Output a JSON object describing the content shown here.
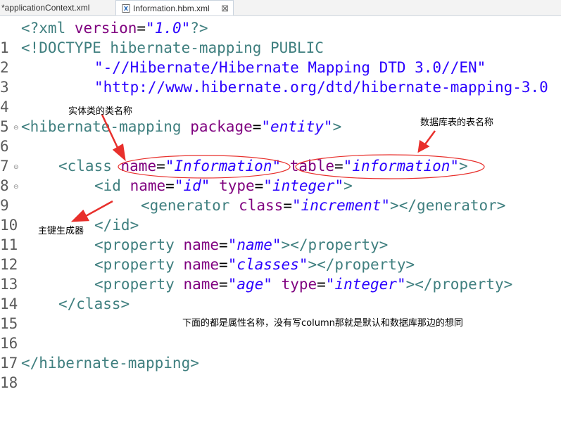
{
  "tabs": [
    {
      "label": "*applicationContext.xml",
      "active": false
    },
    {
      "label": "Information.hbm.xml",
      "active": true
    }
  ],
  "close_glyph": "⊠",
  "colors": {
    "tag": "#3f7f7f",
    "attribute": "#7f007f",
    "attribute_value": "#2a00ff",
    "annotation_red": "#e8302c"
  },
  "editor": {
    "lines": [
      {
        "num": "1"
      },
      {
        "num": "2"
      },
      {
        "num": "3"
      },
      {
        "num": "4"
      },
      {
        "num": "5"
      },
      {
        "num": "6"
      },
      {
        "num": "7"
      },
      {
        "num": "8"
      },
      {
        "num": "9"
      },
      {
        "num": "10"
      },
      {
        "num": "11"
      },
      {
        "num": "12"
      },
      {
        "num": "13"
      },
      {
        "num": "14"
      },
      {
        "num": "15"
      },
      {
        "num": "16"
      },
      {
        "num": "17"
      },
      {
        "num": "18"
      }
    ],
    "tokens": {
      "xml_decl_open": "<?xml",
      "version_attr": "version",
      "version_val": "\"1.0\"",
      "xml_decl_close": "?>",
      "doctype": "<!DOCTYPE hibernate-mapping PUBLIC",
      "dtd_public": "\"-//Hibernate/Hibernate Mapping DTD 3.0//EN\"",
      "dtd_url": "\"http://www.hibernate.org/dtd/hibernate-mapping-3.0",
      "hm_open": "<hibernate-mapping",
      "package_attr": "package",
      "package_val": "\"entity\"",
      "gt": ">",
      "class_open": "<class",
      "name_attr": "name",
      "class_name_val": "\"Information\"",
      "table_attr": "table",
      "table_val": "\"information\"",
      "id_open": "<id",
      "id_name_val": "\"id\"",
      "type_attr": "type",
      "integer_val": "\"integer\"",
      "generator_open": "<generator",
      "class_attr": "class",
      "increment_val": "\"increment\"",
      "generator_close": "></generator>",
      "id_close": "</id>",
      "property_open": "<property",
      "prop_name_val": "\"name\"",
      "prop_classes_val": "\"classes\"",
      "prop_age_val": "\"age\"",
      "property_close": "></property>",
      "class_close": "</class>",
      "hm_close": "</hibernate-mapping>",
      "eq": "="
    }
  },
  "annotations": {
    "entity_class_name": "实体类的类名称",
    "table_name": "数据库表的表名称",
    "primary_key": "主键生成器",
    "property_note": "下面的都是属性名称，没有写column那就是默认和数据库那边的想同"
  }
}
